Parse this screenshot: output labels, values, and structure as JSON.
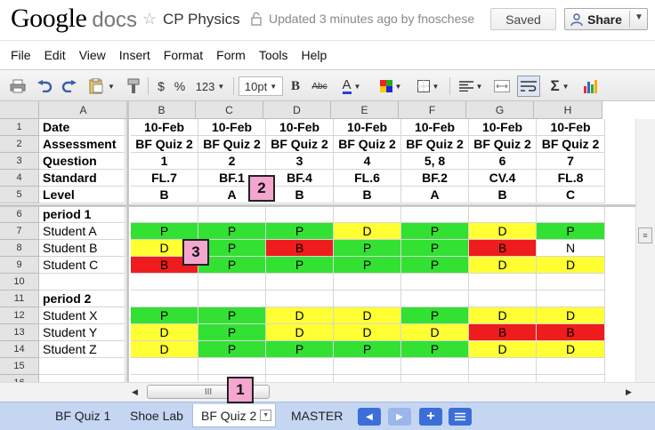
{
  "app": {
    "logo_google": "Google",
    "logo_docs": "docs",
    "doc_title": "CP Physics",
    "status": "Updated 3 minutes ago by fnoschese",
    "saved_label": "Saved",
    "share_label": "Share"
  },
  "menu": [
    "File",
    "Edit",
    "View",
    "Insert",
    "Format",
    "Form",
    "Tools",
    "Help"
  ],
  "toolbar": {
    "currency": "$",
    "percent": "%",
    "number_format": "123",
    "font_size": "10pt",
    "bold": "B",
    "strikethrough": "Abc",
    "text_color": "A",
    "sum": "Σ"
  },
  "columns": [
    "A",
    "B",
    "C",
    "D",
    "E",
    "F",
    "G",
    "H"
  ],
  "rows": [
    "1",
    "2",
    "3",
    "4",
    "5",
    "6",
    "7",
    "8",
    "9",
    "10",
    "11",
    "12",
    "13",
    "14",
    "15",
    "16"
  ],
  "sheet": {
    "r1": [
      "Date",
      "10-Feb",
      "10-Feb",
      "10-Feb",
      "10-Feb",
      "10-Feb",
      "10-Feb",
      "10-Feb"
    ],
    "r2": [
      "Assessment",
      "BF Quiz 2",
      "BF Quiz 2",
      "BF Quiz 2",
      "BF Quiz 2",
      "BF Quiz 2",
      "BF Quiz 2",
      "BF Quiz 2"
    ],
    "r3": [
      "Question",
      "1",
      "2",
      "3",
      "4",
      "5, 8",
      "6",
      "7"
    ],
    "r4": [
      "Standard",
      "FL.7",
      "BF.1",
      "BF.4",
      "FL.6",
      "BF.2",
      "CV.4",
      "FL.8"
    ],
    "r5": [
      "Level",
      "B",
      "A",
      "B",
      "B",
      "A",
      "B",
      "C"
    ],
    "r6": [
      "period 1",
      "",
      "",
      "",
      "",
      "",
      "",
      ""
    ],
    "r7": [
      "Student A",
      "P",
      "P",
      "P",
      "D",
      "P",
      "D",
      "P"
    ],
    "r8": [
      "Student B",
      "D",
      "P",
      "B",
      "P",
      "P",
      "B",
      "N"
    ],
    "r9": [
      "Student C",
      "B",
      "P",
      "P",
      "P",
      "P",
      "D",
      "D"
    ],
    "r10": [
      "",
      "",
      "",
      "",
      "",
      "",
      "",
      ""
    ],
    "r11": [
      "period 2",
      "",
      "",
      "",
      "",
      "",
      "",
      ""
    ],
    "r12": [
      "Student X",
      "P",
      "P",
      "D",
      "D",
      "P",
      "D",
      "D"
    ],
    "r13": [
      "Student Y",
      "D",
      "P",
      "D",
      "D",
      "D",
      "B",
      "B"
    ],
    "r14": [
      "Student Z",
      "D",
      "P",
      "P",
      "P",
      "P",
      "D",
      "D"
    ],
    "r15": [
      "",
      "",
      "",
      "",
      "",
      "",
      "",
      ""
    ],
    "r16": [
      "",
      "",
      "",
      "",
      "",
      "",
      "",
      ""
    ]
  },
  "grade_colors": {
    "P": "#33e133",
    "D": "#ffff33",
    "B": "#ee1c1c",
    "N": "#ffffff"
  },
  "tabs": [
    "BF Quiz 1",
    "Shoe Lab",
    "BF Quiz 2",
    "MASTER"
  ],
  "active_tab": "BF Quiz 2",
  "callouts": [
    "1",
    "2",
    "3"
  ],
  "scroll_thumb": "III"
}
